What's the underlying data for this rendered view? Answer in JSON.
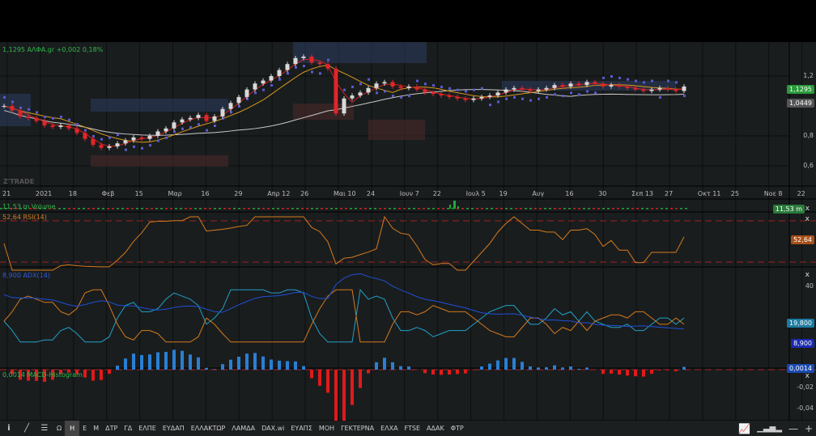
{
  "header": {
    "quote": "1,1295 ΑΛΦΑ.gr +0,002 0,18%"
  },
  "watermark": "Z'TRADE",
  "price_axis": {
    "ticks": [
      "1,2",
      "0,8",
      "0,6"
    ],
    "last_price": "1,1295",
    "ma_value": "1,0449"
  },
  "date_axis": [
    "21",
    "2021",
    "18",
    "Φεβ",
    "15",
    "Μαρ",
    "16",
    "29",
    "Απρ 12",
    "26",
    "Μαι 10",
    "24",
    "Ιουν 7",
    "22",
    "Ιουλ 5",
    "19",
    "Αυγ",
    "16",
    "30",
    "Σεπ 13",
    "27",
    "Οκτ 11",
    "25",
    "Νοε 8",
    "22"
  ],
  "volume": {
    "label": "11,53 m Volume",
    "value": "11,53 m"
  },
  "rsi": {
    "label": "52,64 RSI(14)",
    "value": "52,64",
    "close": "x"
  },
  "adx": {
    "label": "8,900 ADX(14)",
    "ticks": [
      "40"
    ],
    "di_value": "19,800",
    "adx_value": "8,900",
    "close": "x"
  },
  "macd": {
    "label": "0,0014 MACD-Histogram",
    "value": "0,0014",
    "ticks": [
      "-0,02",
      "-0,04"
    ],
    "close": "x"
  },
  "colors": {
    "up": "#d8d8d8",
    "down": "#e0262a",
    "bg": "#1a1d1e",
    "volume": "#22a83a",
    "rsi": "#d47a1c",
    "adx": "#1e50d8",
    "diplus": "#20a0c8",
    "macd_pos": "#2a7fd4",
    "macd_neg": "#e01a1a"
  },
  "toolbar": {
    "tabs": [
      "Ω",
      "Η",
      "Ε",
      "Μ",
      "ΔΤΡ",
      "ΓΔ",
      "ΕΛΠΕ",
      "ΕΥΔΑΠ",
      "ΕΛΛΑΚΤΩΡ",
      "ΛΑΜΔΑ",
      "DAX.wi",
      "ΕΥΑΠΣ",
      "ΜΟΗ",
      "ΓΕΚΤΕΡΝΑ",
      "ΕΛΧΑ",
      "FTSE",
      "ΑΔΑΚ",
      "ΦΤΡ"
    ],
    "selected": "Η",
    "info": "i",
    "minus": "—",
    "plus": "+"
  },
  "chart_data": {
    "type": "candlestick",
    "title": "ΑΛΦΑ.gr",
    "ylim": [
      0.55,
      1.42
    ],
    "closes": [
      1.0,
      0.97,
      0.93,
      0.92,
      0.9,
      0.87,
      0.86,
      0.87,
      0.85,
      0.82,
      0.78,
      0.74,
      0.72,
      0.73,
      0.75,
      0.77,
      0.79,
      0.78,
      0.8,
      0.83,
      0.85,
      0.89,
      0.91,
      0.92,
      0.94,
      0.9,
      0.93,
      0.98,
      1.02,
      1.06,
      1.11,
      1.15,
      1.17,
      1.2,
      1.24,
      1.28,
      1.32,
      1.33,
      1.29,
      1.28,
      1.25,
      0.95,
      1.05,
      1.07,
      1.09,
      1.12,
      1.15,
      1.16,
      1.13,
      1.12,
      1.13,
      1.11,
      1.09,
      1.08,
      1.07,
      1.06,
      1.05,
      1.04,
      1.05,
      1.06,
      1.07,
      1.09,
      1.11,
      1.12,
      1.11,
      1.1,
      1.11,
      1.12,
      1.14,
      1.13,
      1.15,
      1.14,
      1.16,
      1.15,
      1.13,
      1.14,
      1.13,
      1.12,
      1.11,
      1.1,
      1.11,
      1.12,
      1.11,
      1.1,
      1.13
    ]
  }
}
